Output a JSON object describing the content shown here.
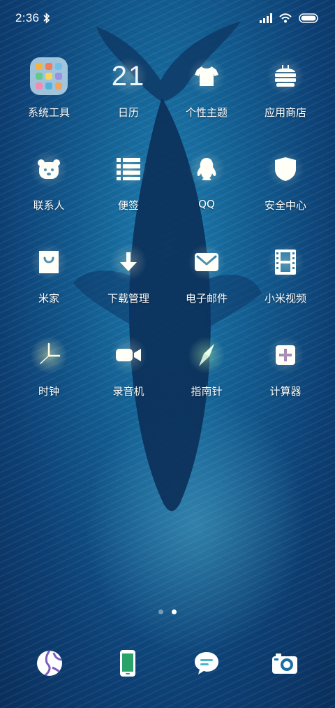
{
  "status_bar": {
    "time": "2:36",
    "icons": [
      "bluetooth-icon",
      "signal-icon",
      "wifi-icon",
      "battery-icon"
    ]
  },
  "apps": [
    {
      "name": "system-tools",
      "label": "系统工具",
      "icon": "folder-icon"
    },
    {
      "name": "calendar",
      "label": "日历",
      "icon": "calendar-icon",
      "date": "21"
    },
    {
      "name": "themes",
      "label": "个性主题",
      "icon": "shirt-icon"
    },
    {
      "name": "app-store",
      "label": "应用商店",
      "icon": "store-bag-icon"
    },
    {
      "name": "contacts",
      "label": "联系人",
      "icon": "bear-face-icon"
    },
    {
      "name": "notes",
      "label": "便签",
      "icon": "notes-list-icon"
    },
    {
      "name": "qq",
      "label": "QQ",
      "icon": "penguin-icon"
    },
    {
      "name": "security",
      "label": "安全中心",
      "icon": "shield-icon"
    },
    {
      "name": "mijia",
      "label": "米家",
      "icon": "shopping-bag-icon"
    },
    {
      "name": "downloads",
      "label": "下载管理",
      "icon": "download-arrow-icon"
    },
    {
      "name": "email",
      "label": "电子邮件",
      "icon": "envelope-icon"
    },
    {
      "name": "mi-video",
      "label": "小米视频",
      "icon": "film-strip-icon"
    },
    {
      "name": "clock",
      "label": "时钟",
      "icon": "clock-icon"
    },
    {
      "name": "recorder",
      "label": "录音机",
      "icon": "video-camera-icon"
    },
    {
      "name": "compass",
      "label": "指南针",
      "icon": "compass-icon"
    },
    {
      "name": "calculator",
      "label": "计算器",
      "icon": "calculator-icon"
    }
  ],
  "page_indicator": {
    "count": 2,
    "active": 2
  },
  "dock": [
    {
      "name": "browser",
      "icon": "globe-icon"
    },
    {
      "name": "phone",
      "icon": "phone-icon"
    },
    {
      "name": "messages",
      "icon": "chat-bubble-icon"
    },
    {
      "name": "camera",
      "icon": "camera-icon"
    }
  ],
  "colors": {
    "wallpaper_top": "#1e7fb0",
    "wallpaper_bottom": "#0a2f5c",
    "icon_white": "#ffffff",
    "whale": "#0d2f5a"
  }
}
